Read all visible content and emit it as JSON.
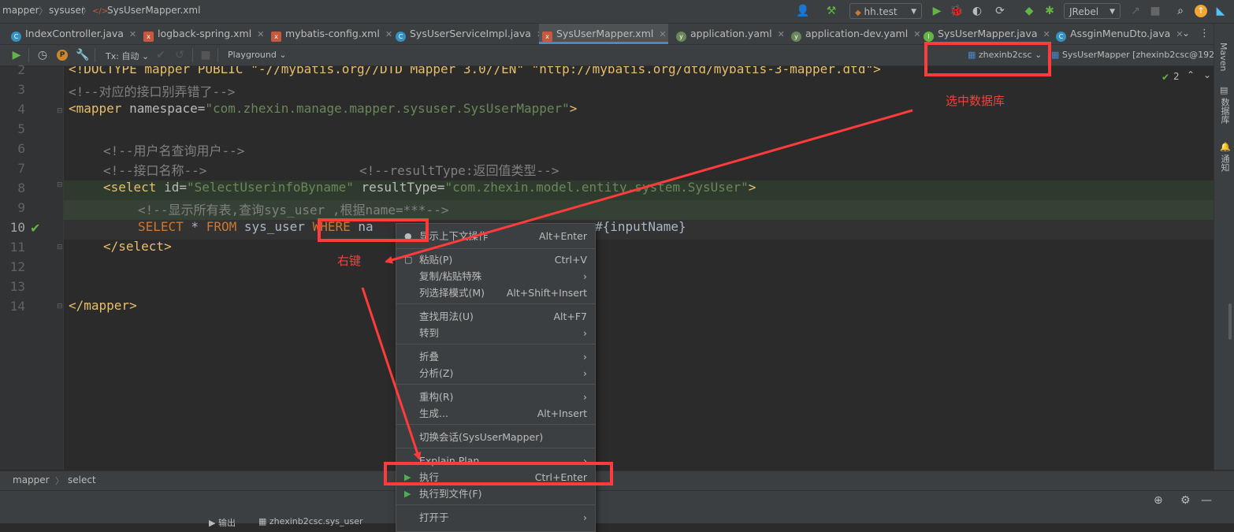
{
  "navbar": {
    "crumbs": [
      "mapper",
      "sysuser",
      "SysUserMapper.xml"
    ],
    "run_config": "hh.test",
    "jrebel": "JRebel"
  },
  "tabs": [
    {
      "label": "IndexController.java",
      "color": "#3592c4",
      "glyph": "C"
    },
    {
      "label": "logback-spring.xml",
      "color": "#c7593f",
      "glyph": "x"
    },
    {
      "label": "mybatis-config.xml",
      "color": "#c7593f",
      "glyph": "x"
    },
    {
      "label": "SysUserServiceImpl.java",
      "color": "#3592c4",
      "glyph": "C"
    },
    {
      "label": "SysUserMapper.xml",
      "color": "#c7593f",
      "glyph": "x",
      "active": true
    },
    {
      "label": "application.yaml",
      "color": "#6a8759",
      "glyph": "y"
    },
    {
      "label": "application-dev.yaml",
      "color": "#6a8759",
      "glyph": "y"
    },
    {
      "label": "SysUserMapper.java",
      "color": "#62b543",
      "glyph": "I"
    },
    {
      "label": "AssginMenuDto.java",
      "color": "#3592c4",
      "glyph": "C"
    }
  ],
  "dbbar": {
    "tx": "Tx: 自动",
    "playground": "Playground",
    "datasource": "zhexinb2csc",
    "session": "SysUserMapper [zhexinb2csc@192..."
  },
  "editor": {
    "line_numbers": [
      "2",
      "3",
      "4",
      "5",
      "6",
      "7",
      "8",
      "9",
      "10",
      "11",
      "12",
      "13",
      "14"
    ],
    "inspections": "2",
    "lines": {
      "l2": "<!DOCTYPE mapper PUBLIC \"-//mybatis.org//DTD Mapper 3.0//EN\" \"http://mybatis.org/dtd/mybatis-3-mapper.dtd\">",
      "l3": "<!--对应的接口别弄错了-->",
      "l4_tag_open": "<mapper ",
      "l4_attr": "namespace=",
      "l4_val": "\"com.zhexin.manage.mapper.sysuser.SysUserMapper\"",
      "l4_close": ">",
      "l6": "<!--用户名查询用户-->",
      "l7a": "<!--接口名称-->",
      "l7b": "<!--resultType:返回值类型-->",
      "l8_tag": "<select ",
      "l8_attr1": "id=",
      "l8_val1": "\"SelectUserinfoByname\"",
      "l8_attr2": " resultType=",
      "l8_val2": "\"com.zhexin.model.entity.system.SysUser\"",
      "l8_close": ">",
      "l9": "<!--显示所有表,查询sys_user ,根据name=***-->",
      "l10_kw1": "SELECT",
      "l10_star": " * ",
      "l10_kw2": "FROM",
      "l10_tbl": " sys_user ",
      "l10_kw3": "WHERE",
      "l10_rest": " na",
      "l10_tail": "#{inputName}",
      "l11": "</select>",
      "l14": "</mapper>"
    }
  },
  "context_menu": {
    "items": [
      {
        "label": "显示上下文操作",
        "shortcut": "Alt+Enter"
      },
      {
        "label": "粘贴(P)",
        "shortcut": "Ctrl+V"
      },
      {
        "label": "复制/粘贴特殊",
        "shortcut": ""
      },
      {
        "label": "列选择模式(M)",
        "shortcut": "Alt+Shift+Insert"
      },
      {
        "label": "查找用法(U)",
        "shortcut": "Alt+F7"
      },
      {
        "label": "转到",
        "shortcut": ""
      },
      {
        "label": "折叠",
        "shortcut": ""
      },
      {
        "label": "分析(Z)",
        "shortcut": ""
      },
      {
        "label": "重构(R)",
        "shortcut": ""
      },
      {
        "label": "生成...",
        "shortcut": "Alt+Insert"
      },
      {
        "label": "切换会话(SysUserMapper)",
        "shortcut": ""
      },
      {
        "label": "Explain Plan",
        "shortcut": ""
      },
      {
        "label": "执行",
        "shortcut": "Ctrl+Enter"
      },
      {
        "label": "执行到文件(F)",
        "shortcut": ""
      },
      {
        "label": "打开于",
        "shortcut": ""
      }
    ]
  },
  "annotations": {
    "select_db": "选中数据库",
    "right_click": "右键"
  },
  "right_strip": {
    "maven": "Maven",
    "database": "数据库",
    "notifications": "通知"
  },
  "bottom": {
    "crumbs": [
      "mapper",
      "select"
    ],
    "tab1": "输出",
    "tab2": "zhexinb2csc.sys_user"
  }
}
